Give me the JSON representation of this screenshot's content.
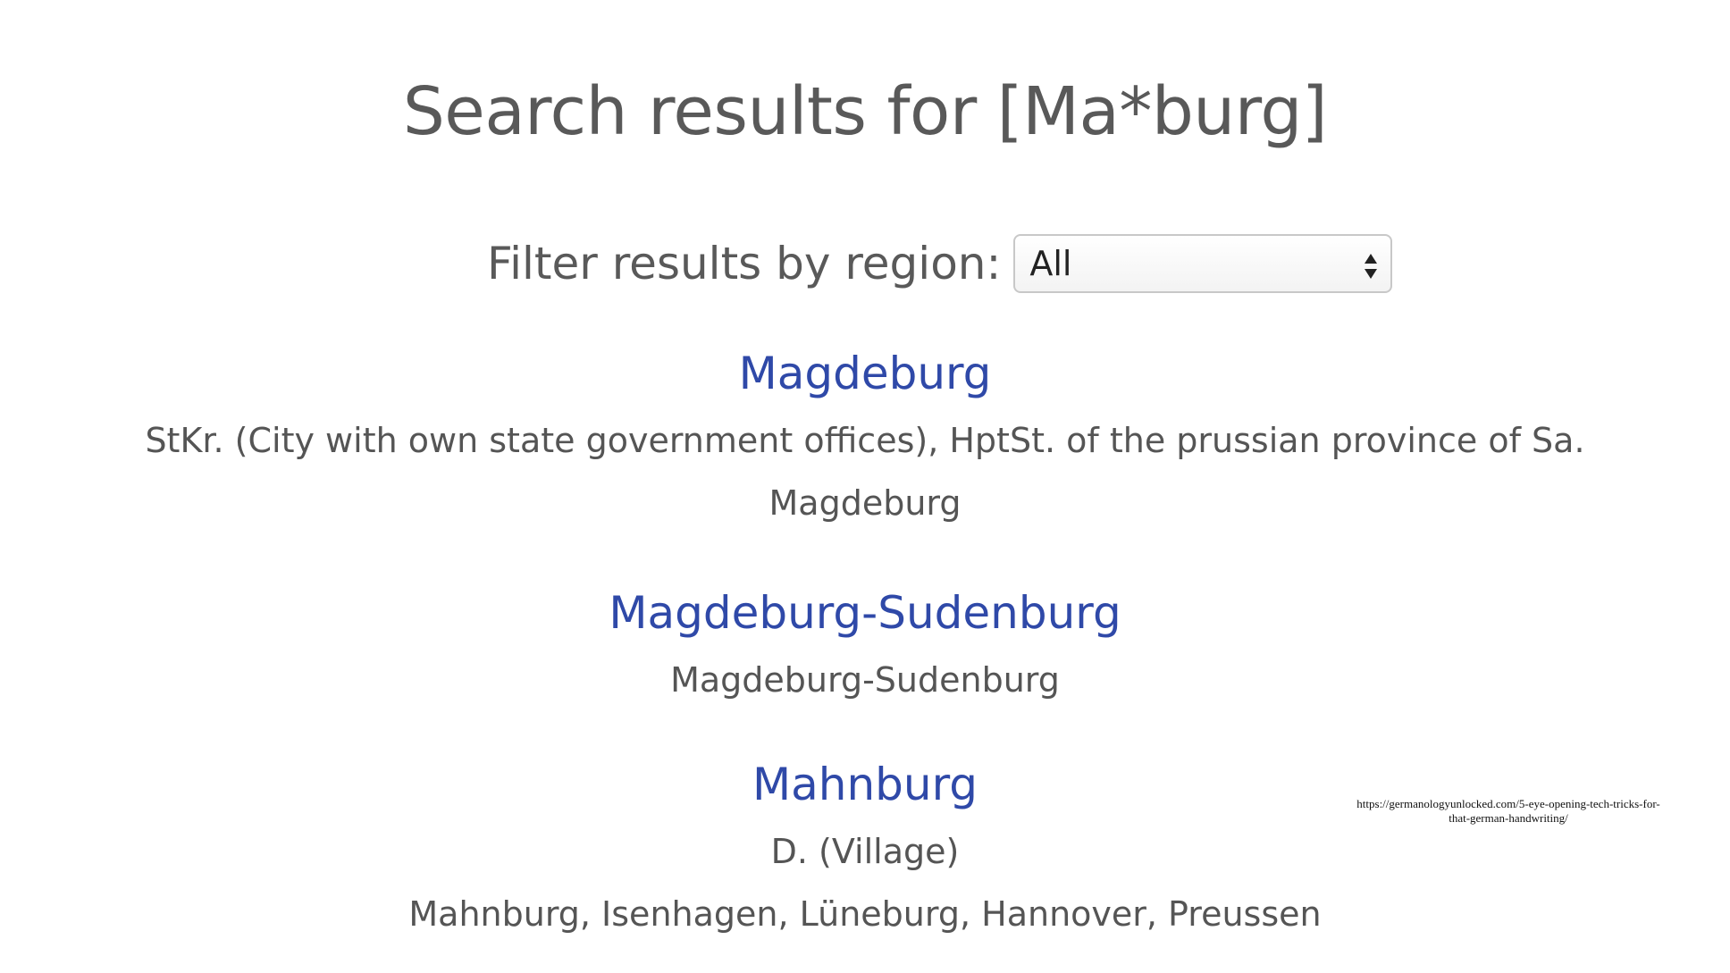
{
  "page": {
    "title": "Search results for [Ma*burg]"
  },
  "filter": {
    "label": "Filter results by region:",
    "selected": "All"
  },
  "results": [
    {
      "name": "Magdeburg",
      "details": [
        "StKr. (City with own state government offices), HptSt. of the prussian province of Sa.",
        "Magdeburg"
      ]
    },
    {
      "name": "Magdeburg-Sudenburg",
      "details": [
        "Magdeburg-Sudenburg"
      ]
    },
    {
      "name": "Mahnburg",
      "details": [
        "D. (Village)",
        "Mahnburg, Isenhagen, Lüneburg, Hannover, Preussen"
      ]
    }
  ],
  "source": {
    "url": "https://germanologyunlocked.com/5-eye-opening-tech-tricks-for-that-german-handwriting/"
  },
  "colors": {
    "link": "#2f49a8",
    "text": "#555555",
    "title": "#595959"
  }
}
